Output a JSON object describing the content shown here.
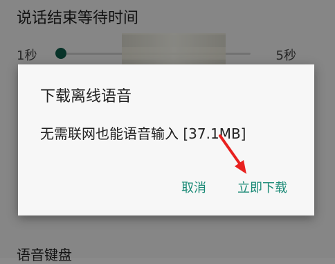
{
  "settings": {
    "section_title": "说话结束等待时间",
    "slider_min": "1秒",
    "slider_max": "5秒",
    "slider_value": 0.0,
    "bottom_label": "语音键盘"
  },
  "dialog": {
    "title": "下载离线语音",
    "body": "无需联网也能语音输入 [37.1MB]",
    "cancel": "取消",
    "download": "立即下载"
  },
  "colors": {
    "accent": "#1a8a76",
    "arrow": "#e8211f",
    "thumb": "#0f5e4c"
  }
}
